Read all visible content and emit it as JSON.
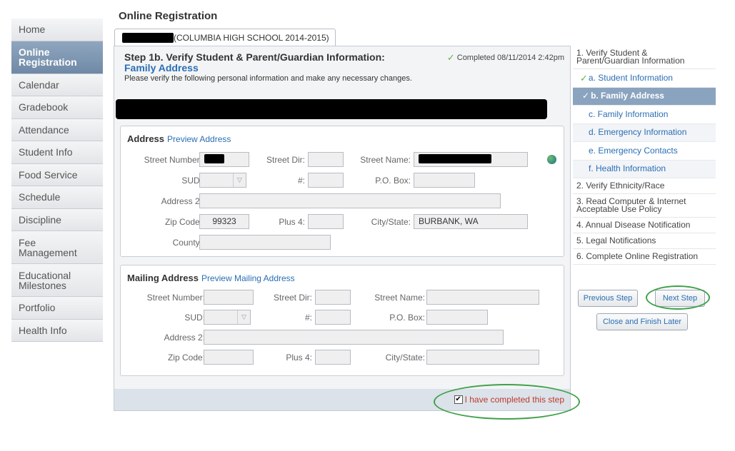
{
  "nav": {
    "items": [
      {
        "label": "Home"
      },
      {
        "label": "Online Registration"
      },
      {
        "label": "Calendar"
      },
      {
        "label": "Gradebook"
      },
      {
        "label": "Attendance"
      },
      {
        "label": "Student Info"
      },
      {
        "label": "Food Service"
      },
      {
        "label": "Schedule"
      },
      {
        "label": "Discipline"
      },
      {
        "label": "Fee Management"
      },
      {
        "label": "Educational Milestones"
      },
      {
        "label": "Portfolio"
      },
      {
        "label": "Health Info"
      }
    ]
  },
  "page_title": "Online Registration",
  "school_tab": "(COLUMBIA HIGH SCHOOL 2014-2015)",
  "step": {
    "title": "Step 1b. Verify Student & Parent/Guardian Information:",
    "subtitle": "Family Address",
    "description": "Please verify the following personal information and make any necessary changes.",
    "completed": "Completed 08/11/2014 2:42pm"
  },
  "address": {
    "title": "Address",
    "preview_link": "Preview Address",
    "street_number_label": "Street Number:",
    "street_dir_label": "Street Dir:",
    "street_name_label": "Street Name:",
    "sud_label": "SUD:",
    "hash_label": "#:",
    "po_box_label": "P.O. Box:",
    "address2_label": "Address 2:",
    "zip_label": "Zip Code:",
    "zip_value": "99323",
    "plus4_label": "Plus 4:",
    "city_state_label": "City/State:",
    "city_state_value": "BURBANK, WA",
    "county_label": "County:"
  },
  "mailing": {
    "title": "Mailing Address",
    "preview_link": "Preview Mailing Address",
    "street_number_label": "Street Number:",
    "street_dir_label": "Street Dir:",
    "street_name_label": "Street Name:",
    "sud_label": "SUD:",
    "hash_label": "#:",
    "po_box_label": "P.O. Box:",
    "address2_label": "Address 2:",
    "zip_label": "Zip Code:",
    "plus4_label": "Plus 4:",
    "city_state_label": "City/State:"
  },
  "complete_checkbox": "I have completed this step",
  "steps": {
    "s1": "1. Verify Student & Parent/Guardian Information",
    "s1a": "a. Student Information",
    "s1b": "b. Family Address",
    "s1c": "c. Family Information",
    "s1d": "d. Emergency Information",
    "s1e": "e. Emergency Contacts",
    "s1f": "f. Health Information",
    "s2": "2. Verify Ethnicity/Race",
    "s3": "3. Read Computer & Internet Acceptable Use Policy",
    "s4": "4. Annual Disease Notification",
    "s5": "5. Legal Notifications",
    "s6": "6. Complete Online Registration"
  },
  "buttons": {
    "previous": "Previous Step",
    "next": "Next Step",
    "close": "Close and Finish Later"
  },
  "icons": {
    "completed": "check-icon",
    "map": "globe-icon"
  },
  "colors": {
    "accent": "#2a6fb4",
    "nav_active": "#7a93ae",
    "highlight_oval": "#3fa14a",
    "warning_text": "#c0392b"
  }
}
